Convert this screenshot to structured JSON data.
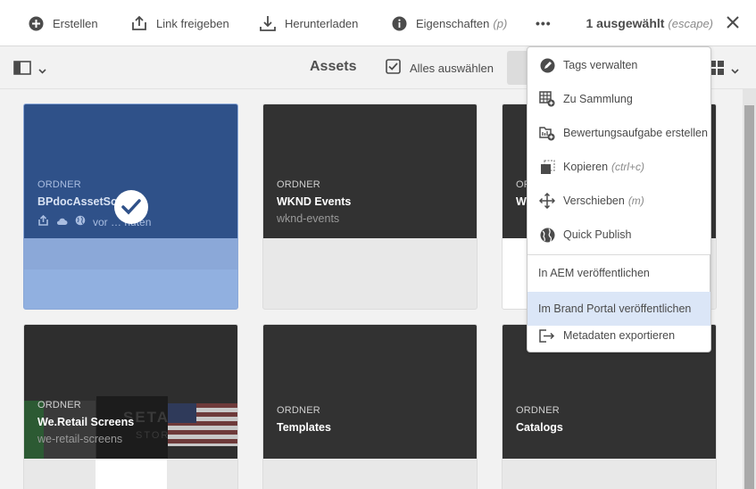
{
  "actionbar": {
    "create_label": "Erstellen",
    "share_label": "Link freigeben",
    "download_label": "Herunterladen",
    "properties_label": "Eigenschaften",
    "properties_shortcut": "(p)",
    "more_label": "•••",
    "selection_count": "1 ausgewählt",
    "selection_shortcut": "(escape)"
  },
  "toolbar": {
    "title": "Assets",
    "select_all_label": "Alles auswählen"
  },
  "cards": [
    {
      "type": "ORDNER",
      "name": "BPdocAssetSourc",
      "sub": "vor … nuten",
      "selected": true
    },
    {
      "type": "ORDNER",
      "name": "WKND Events",
      "sub": "wknd-events",
      "selected": false
    },
    {
      "type": "OR",
      "name": "W",
      "sub": "",
      "selected": false
    },
    {
      "type": "ORDNER",
      "name": "We.Retail Screens",
      "sub": "we-retail-screens",
      "selected": false
    },
    {
      "type": "ORDNER",
      "name": "Templates",
      "sub": "",
      "selected": false
    },
    {
      "type": "ORDNER",
      "name": "Catalogs",
      "sub": "",
      "selected": false
    }
  ],
  "thumb_text": {
    "line1": "SETA",
    "line2": "STORE"
  },
  "menu": {
    "items": [
      {
        "label": "Tags verwalten",
        "shortcut": "",
        "icon": "tag-icon"
      },
      {
        "label": "Zu Sammlung",
        "shortcut": "",
        "icon": "add-to-collection-icon"
      },
      {
        "label": "Bewertungsaufgabe erstellen",
        "shortcut": "",
        "icon": "review-task-icon"
      },
      {
        "label": "Kopieren",
        "shortcut": "(ctrl+c)",
        "icon": "copy-icon"
      },
      {
        "label": "Verschieben",
        "shortcut": "(m)",
        "icon": "move-icon"
      },
      {
        "label": "Quick Publish",
        "shortcut": "",
        "icon": "globe-icon"
      }
    ],
    "sub_items": [
      {
        "label": "In AEM veröffentlichen"
      },
      {
        "label": "Im Brand Portal veröffentlichen"
      }
    ],
    "export_label": "Metadaten exportieren"
  },
  "colors": {
    "accent": "#2f5189",
    "selected_card": "#8ba8d8",
    "highlight": "#dbe6f7",
    "dark_thumb": "#323232"
  }
}
